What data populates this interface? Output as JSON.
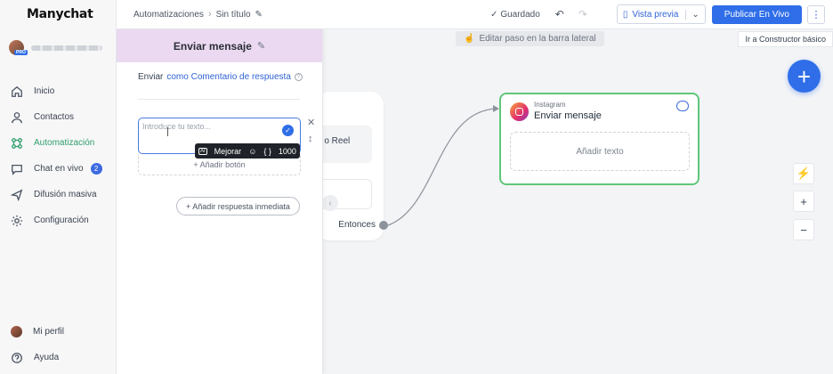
{
  "app": {
    "logo": "Manychat"
  },
  "sidebar": {
    "items": [
      {
        "label": "Inicio",
        "icon": "home-icon"
      },
      {
        "label": "Contactos",
        "icon": "user-icon"
      },
      {
        "label": "Automatización",
        "icon": "automation-icon",
        "active": true
      },
      {
        "label": "Chat en vivo",
        "icon": "chat-icon",
        "badge": "2"
      },
      {
        "label": "Difusión masiva",
        "icon": "send-icon"
      },
      {
        "label": "Configuración",
        "icon": "gear-icon"
      }
    ],
    "bottom": [
      {
        "label": "Mi perfil"
      },
      {
        "label": "Ayuda"
      }
    ],
    "account_badge": "PRO"
  },
  "topbar": {
    "breadcrumb_parent": "Automatizaciones",
    "breadcrumb_current": "Sin título",
    "saved_label": "Guardado",
    "preview_label": "Vista previa",
    "publish_label": "Publicar En Vivo"
  },
  "canvas": {
    "hint": "Editar paso en la barra lateral",
    "basic_builder": "Ir a Constructor básico",
    "node1_partial_text": "n o Reel",
    "node1_then": "Entonces",
    "node2_source": "Instagram",
    "node2_title": "Enviar mensaje",
    "node2_add_text": "Añadir texto"
  },
  "panel": {
    "title": "Enviar mensaje",
    "send_prefix": "Enviar",
    "send_link": "como Comentario de respuesta",
    "editor_placeholder": "Introduce tu texto...",
    "toolbar_improve": "Mejorar",
    "toolbar_count": "1000",
    "add_button": "+ Añadir botón",
    "quick_reply": "+ Añadir respuesta inmediata"
  },
  "colors": {
    "accent": "#2f6ee8",
    "success": "#5fc77a",
    "panel_header": "#ebd9f1",
    "active_nav": "#2f9e6b"
  }
}
